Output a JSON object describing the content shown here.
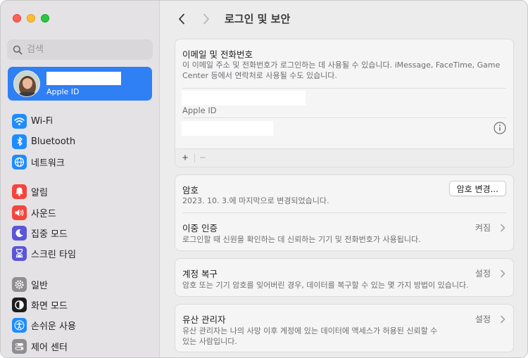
{
  "window": {
    "traffic_lights": [
      "close",
      "minimize",
      "zoom"
    ]
  },
  "sidebar": {
    "search": {
      "placeholder": "검색",
      "value": ""
    },
    "account": {
      "subtitle": "Apple ID"
    },
    "items": [
      {
        "label": "Wi-Fi",
        "icon": "wifi-icon",
        "color": "#1e8cff"
      },
      {
        "label": "Bluetooth",
        "icon": "bluetooth-icon",
        "color": "#1e8cff"
      },
      {
        "label": "네트워크",
        "icon": "globe-icon",
        "color": "#1e8cff"
      },
      {
        "label": "알림",
        "icon": "bell-icon",
        "color": "#f4453c"
      },
      {
        "label": "사운드",
        "icon": "speaker-icon",
        "color": "#f4453c"
      },
      {
        "label": "집중 모드",
        "icon": "moon-icon",
        "color": "#5b55d8"
      },
      {
        "label": "스크린 타임",
        "icon": "hourglass-icon",
        "color": "#5b55d8"
      },
      {
        "label": "일반",
        "icon": "gear-icon",
        "color": "#8e8e93"
      },
      {
        "label": "화면 모드",
        "icon": "appearance-icon",
        "color": "#1c1c1e"
      },
      {
        "label": "손쉬운 사용",
        "icon": "accessibility-icon",
        "color": "#1e8cff"
      },
      {
        "label": "제어 센터",
        "icon": "control-center-icon",
        "color": "#8e8e93"
      }
    ]
  },
  "main": {
    "title": "로그인 및 보안",
    "email_card": {
      "title": "이메일 및 전화번호",
      "description": "이 이메일 주소 및 전화번호가 로그인하는 데 사용될 수 있습니다. iMessage, FaceTime, Game Center 등에서 연락처로 사용될 수도 있습니다.",
      "entry_label": "Apple ID",
      "add_label": "+",
      "remove_label": "−"
    },
    "password_card": {
      "title": "암호",
      "description": "2023. 10. 3.에 마지막으로 변경되었습니다.",
      "button": "암호 변경...",
      "twofa_title": "이중 인증",
      "twofa_value": "켜짐",
      "twofa_description": "로그인할 때 신원을 확인하는 데 신뢰하는 기기 및 전화번호가 사용됩니다."
    },
    "recovery_card": {
      "title": "계정 복구",
      "value": "설정",
      "description": "암호 또는 기기 암호를 잊어버린 경우, 데이터를 복구할 수 있는 몇 가지 방법이 있습니다."
    },
    "legacy_card": {
      "title": "유산 관리자",
      "value": "설정",
      "description": "유산 관리자는 나의 사망 이후 계정에 있는 데이터에 액세스가 허용된 신뢰할 수 있는 사람입니다."
    }
  }
}
